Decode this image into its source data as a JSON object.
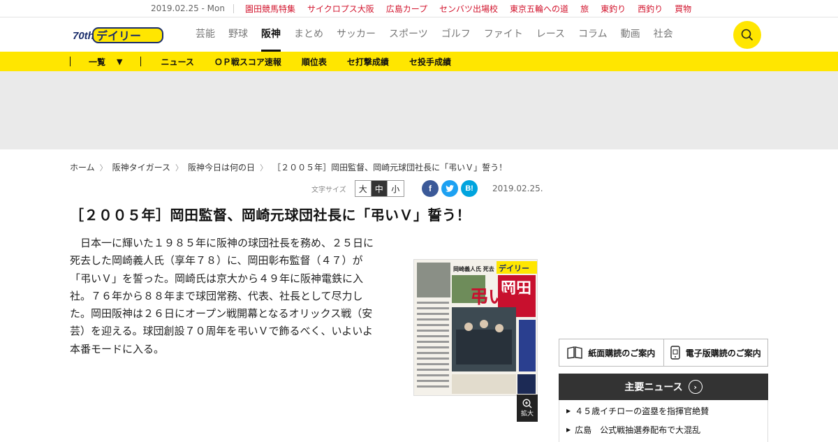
{
  "topbar": {
    "date": "2019.02.25 - Mon",
    "links": [
      "園田競馬特集",
      "サイクロプス大阪",
      "広島カープ",
      "センバツ出場校",
      "東京五輪への道",
      "旅",
      "東釣り",
      "西釣り",
      "買物"
    ]
  },
  "logo": {
    "text": "デイリー",
    "anniv": "70th"
  },
  "nav": [
    "芸能",
    "野球",
    "阪神",
    "まとめ",
    "サッカー",
    "スポーツ",
    "ゴルフ",
    "ファイト",
    "レース",
    "コラム",
    "動画",
    "社会"
  ],
  "nav_active": "阪神",
  "subnav": {
    "list_label": "一覧",
    "items": [
      "ニュース",
      "ＯＰ戦スコア速報",
      "順位表",
      "セ打撃成績",
      "セ投手成績"
    ]
  },
  "breadcrumb": [
    "ホーム",
    "阪神タイガース",
    "阪神今日は何の日",
    "［２００５年］岡田監督、岡崎元球団社長に「弔いＶ」誓う！"
  ],
  "fontsize": {
    "label": "文字サイズ",
    "options": [
      "大",
      "中",
      "小"
    ],
    "selected": "中"
  },
  "share": {
    "facebook": "f",
    "twitter": "t",
    "hatena": "B!"
  },
  "article": {
    "date": "2019.02.25.",
    "title": "［２００５年］岡田監督、岡崎元球団社長に「弔いＶ」誓う！",
    "lines": [
      "　日本一に輝いた１９８５年に阪神の球団社長を務め、２５日に",
      "死去した岡崎義人氏（享年７８）に、岡田彰布監督（４７）が",
      "「弔いＶ」を誓った。岡崎氏は京大から４９年に阪神電鉄に入",
      "社。７６年から８８年まで球団常務、代表、社長として尽力し",
      "た。岡田阪神は２６日にオープン戦開幕となるオリックス戦（安",
      "芸）を迎える。球団創設７０周年を弔いＶで飾るべく、いよいよ",
      "本番モードに入る。"
    ],
    "zoom_label": "拡大",
    "paper": {
      "masthead": "デイリー",
      "headline_big": "岡田",
      "headline_v": "弔いV",
      "side": "岡崎義人氏 死去"
    }
  },
  "sidebar": {
    "subscribe_paper": "紙面購読のご案内",
    "subscribe_digital": "電子版購読のご案内",
    "news_title": "主要ニュース",
    "news": [
      "４５歳イチローの盗塁を指揮官絶賛",
      "広島　公式戦抽選券配布で大混乱"
    ]
  },
  "colors": {
    "accent_yellow": "#ffe600",
    "link_red": "#d2142d",
    "dark": "#333333"
  }
}
